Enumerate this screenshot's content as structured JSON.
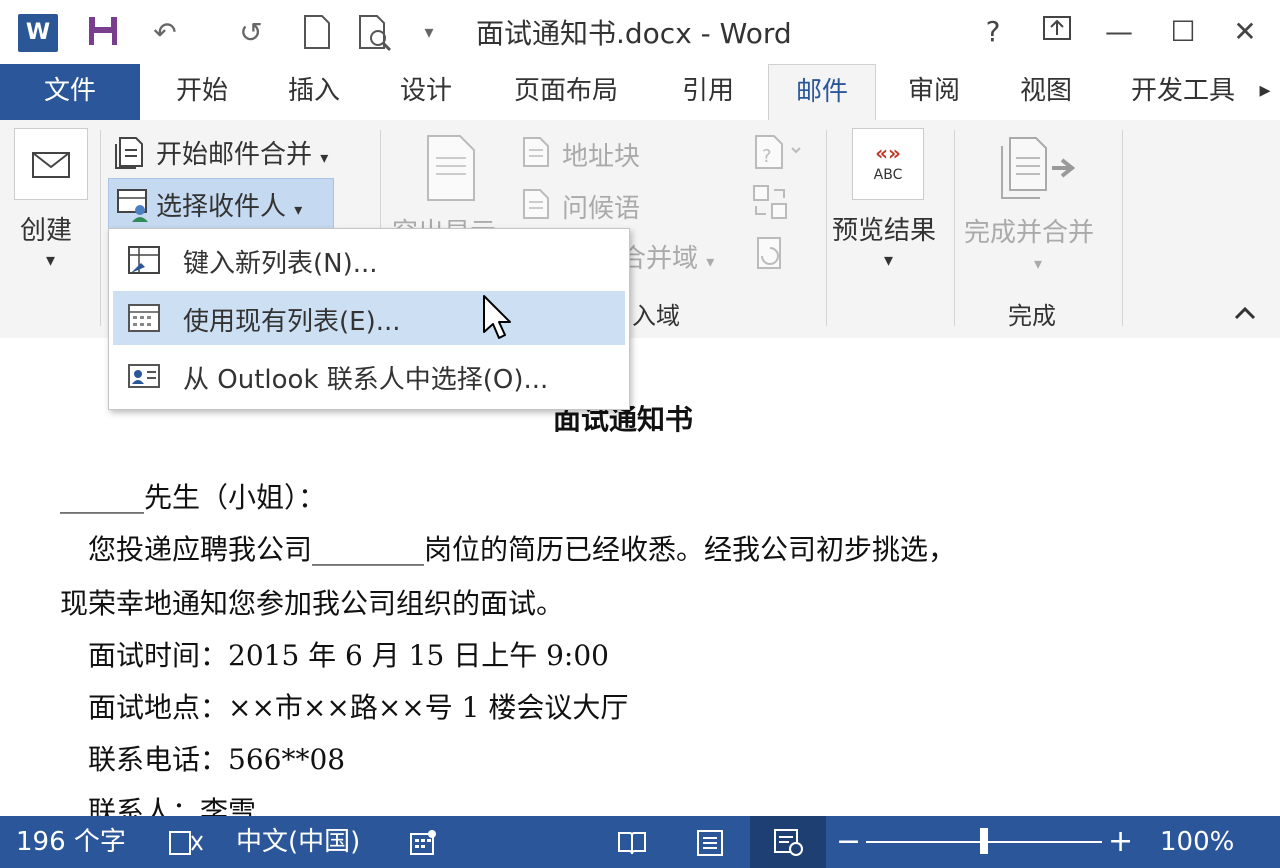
{
  "window": {
    "title": "面试通知书.docx - Word",
    "logo_letter": "W",
    "help": "?",
    "controls": {
      "minimize": "—",
      "restore": "☐",
      "close": "✕"
    }
  },
  "tabs": [
    "文件",
    "开始",
    "插入",
    "设计",
    "页面布局",
    "引用",
    "邮件",
    "审阅",
    "视图",
    "开发工具"
  ],
  "active_tab": "邮件",
  "ribbon": {
    "create": "创建",
    "start_merge": "开始邮件合并",
    "select_recipients": "选择收件人",
    "highlight_partial": "突出显示",
    "address_block": "地址块",
    "greeting_line": "问候语",
    "merge_field_partial": "合并域",
    "group_insert_partial": "入域",
    "abc_marks": "«»",
    "abc": "ABC",
    "preview_results": "预览结果",
    "finish_merge": "完成并合并",
    "group_finish": "完成",
    "collapse": "^"
  },
  "dropdown": {
    "items": [
      {
        "label": "键入新列表(N)..."
      },
      {
        "label": "使用现有列表(E)..."
      },
      {
        "label": "从 Outlook 联系人中选择(O)..."
      }
    ]
  },
  "document": {
    "title": "面试通知书",
    "lines": [
      "______先生（小姐）：",
      "　您投递应聘我公司________岗位的简历已经收悉。经我公司初步挑选，",
      "现荣幸地通知您参加我公司组织的面试。",
      "　面试时间：2015 年 6 月 15 日上午 9:00",
      "　面试地点：××市××路××号 1 楼会议大厅",
      "　联系电话：566**08",
      "　联系人：李雪"
    ]
  },
  "status": {
    "word_count": "196 个字",
    "language": "中文(中国)",
    "zoom_minus": "−",
    "zoom_plus": "+",
    "zoom": "100%",
    "zoom_level": 0.5
  },
  "colors": {
    "accent": "#2b579a",
    "highlight": "#cddff3"
  }
}
